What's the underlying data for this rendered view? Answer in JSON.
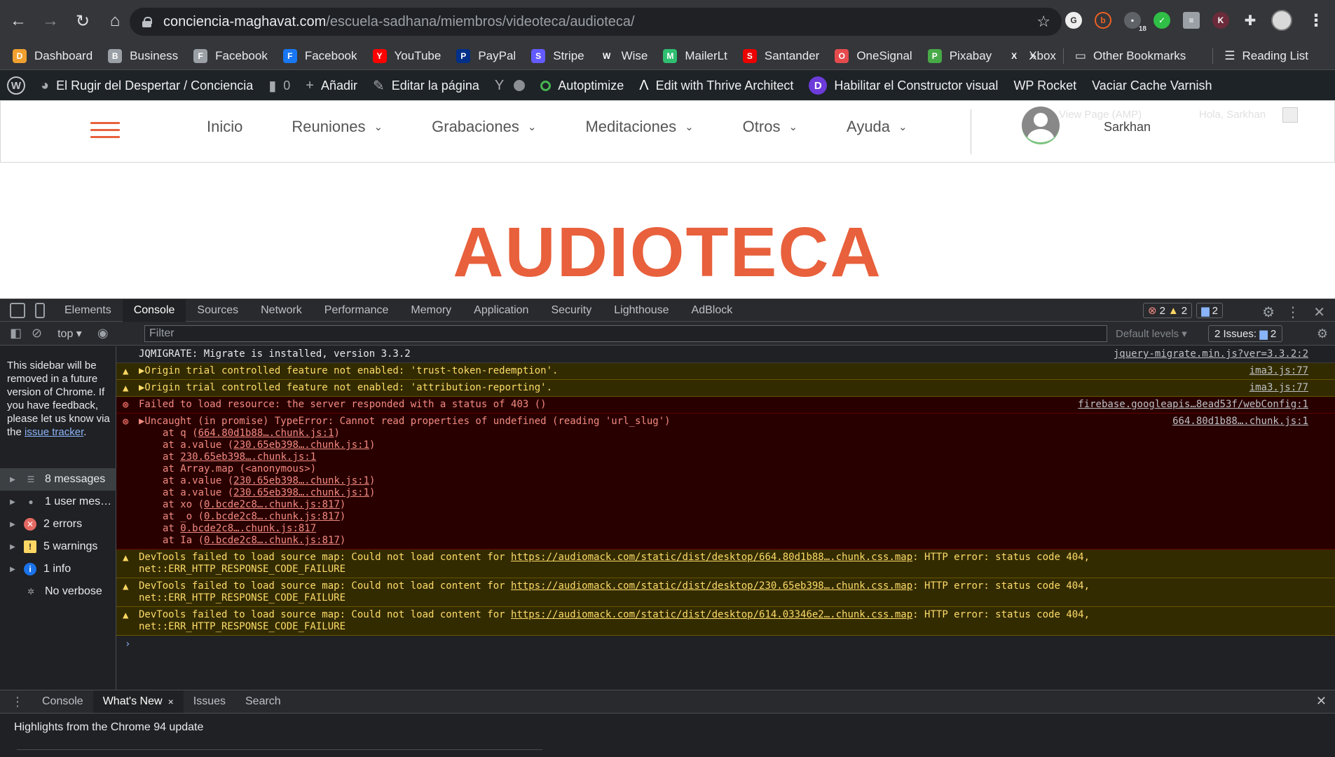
{
  "browser": {
    "url_host": "conciencia-maghavat.com",
    "url_path": "/escuela-sadhana/miembros/videoteca/audioteca/",
    "ext_badge": "18"
  },
  "bookmarks": {
    "items": [
      {
        "label": "Dashboard",
        "icon": "dashboard-icon",
        "color": "#f0a030"
      },
      {
        "label": "Business",
        "icon": "business-icon",
        "color": "#9aa0a6"
      },
      {
        "label": "Facebook",
        "icon": "facebook-doc-icon",
        "color": "#9aa0a6"
      },
      {
        "label": "Facebook",
        "icon": "facebook-icon",
        "color": "#1877f2"
      },
      {
        "label": "YouTube",
        "icon": "youtube-icon",
        "color": "#ff0000"
      },
      {
        "label": "PayPal",
        "icon": "paypal-icon",
        "color": "#003087"
      },
      {
        "label": "Stripe",
        "icon": "stripe-icon",
        "color": "#635bff"
      },
      {
        "label": "Wise",
        "icon": "wise-icon",
        "color": "#35363a"
      },
      {
        "label": "MailerLt",
        "icon": "mailerlite-icon",
        "color": "#2fbf71"
      },
      {
        "label": "Santander",
        "icon": "santander-icon",
        "color": "#ec0000"
      },
      {
        "label": "OneSignal",
        "icon": "onesignal-icon",
        "color": "#e54b4d"
      },
      {
        "label": "Pixabay",
        "icon": "pixabay-icon",
        "color": "#48a948"
      },
      {
        "label": "Xbox",
        "icon": "xbox-icon",
        "color": "#35363a"
      }
    ],
    "overflow": "»",
    "other": "Other Bookmarks",
    "reading": "Reading List"
  },
  "wpbar": {
    "site": "El Rugir del Despertar / Conciencia",
    "comments": "0",
    "add": "Añadir",
    "edit": "Editar la página",
    "autoptimize": "Autoptimize",
    "thrive": "Edit with Thrive Architect",
    "visual": "Habilitar el Constructor visual",
    "rocket": "WP Rocket",
    "varnish": "Vaciar Cache Varnish"
  },
  "site": {
    "menu": [
      {
        "label": "Inicio",
        "chevron": false
      },
      {
        "label": "Reuniones",
        "chevron": true
      },
      {
        "label": "Grabaciones",
        "chevron": true
      },
      {
        "label": "Meditaciones",
        "chevron": true
      },
      {
        "label": "Otros",
        "chevron": true
      },
      {
        "label": "Ayuda",
        "chevron": true
      }
    ],
    "user_name": "Sarkhan",
    "ghost_amp": "View Page (AMP)",
    "ghost_hello": "Hola, Sarkhan",
    "page_title": "AUDIOTECA",
    "accent": "#e8603c"
  },
  "devtools": {
    "tabs": [
      "Elements",
      "Console",
      "Sources",
      "Network",
      "Performance",
      "Memory",
      "Application",
      "Security",
      "Lighthouse",
      "AdBlock"
    ],
    "active_tab": "Console",
    "badge_errors": "2",
    "badge_warnings": "2",
    "badge_info": "2",
    "context": "top",
    "filter_placeholder": "Filter",
    "levels": "Default levels",
    "issues_label": "2 Issues:",
    "issues_count": "2",
    "sidebar_note": "This sidebar will be removed in a future version of Chrome. If you have feedback, please let us know via the",
    "sidebar_link": "issue tracker",
    "sidebar_items": [
      {
        "label": "8 messages",
        "icon": "list-icon",
        "selected": true
      },
      {
        "label": "1 user mes…",
        "icon": "user-icon",
        "selected": false
      },
      {
        "label": "2 errors",
        "icon": "error-icon",
        "selected": false
      },
      {
        "label": "5 warnings",
        "icon": "warning-icon",
        "selected": false
      },
      {
        "label": "1 info",
        "icon": "info-icon",
        "selected": false
      },
      {
        "label": "No verbose",
        "icon": "gear-icon",
        "selected": false
      }
    ],
    "messages": [
      {
        "type": "log",
        "text": "JQMIGRATE: Migrate is installed, version 3.3.2",
        "src": "jquery-migrate.min.js?ver=3.3.2:2"
      },
      {
        "type": "warn",
        "text": "▶Origin trial controlled feature not enabled: 'trust-token-redemption'.",
        "src": "ima3.js:77"
      },
      {
        "type": "warn",
        "text": "▶Origin trial controlled feature not enabled: 'attribution-reporting'.",
        "src": "ima3.js:77"
      },
      {
        "type": "err",
        "text": "Failed to load resource: the server responded with a status of 403 ()",
        "src": "firebase.googleapis…8ead53f/webConfig:1"
      },
      {
        "type": "err",
        "text": "▶Uncaught (in promise) TypeError: Cannot read properties of undefined (reading 'url_slug')",
        "src": "664.80d1b88….chunk.js:1",
        "stack": [
          {
            "pre": "at q (",
            "link": "664.80d1b88….chunk.js:1",
            "post": ")"
          },
          {
            "pre": "at a.value (",
            "link": "230.65eb398….chunk.js:1",
            "post": ")"
          },
          {
            "pre": "at ",
            "link": "230.65eb398….chunk.js:1",
            "post": ""
          },
          {
            "pre": "at Array.map (<anonymous>)",
            "link": "",
            "post": ""
          },
          {
            "pre": "at a.value (",
            "link": "230.65eb398….chunk.js:1",
            "post": ")"
          },
          {
            "pre": "at a.value (",
            "link": "230.65eb398….chunk.js:1",
            "post": ")"
          },
          {
            "pre": "at xo (",
            "link": "0.bcde2c8….chunk.js:817",
            "post": ")"
          },
          {
            "pre": "at _o (",
            "link": "0.bcde2c8….chunk.js:817",
            "post": ")"
          },
          {
            "pre": "at ",
            "link": "0.bcde2c8….chunk.js:817",
            "post": ""
          },
          {
            "pre": "at Ia (",
            "link": "0.bcde2c8….chunk.js:817",
            "post": ")"
          }
        ]
      },
      {
        "type": "warn2",
        "pre": "DevTools failed to load source map: Could not load content for ",
        "link": "https://audiomack.com/static/dist/desktop/664.80d1b88….chunk.css.map",
        "post": ": HTTP error: status code 404,",
        "line2": "net::ERR_HTTP_RESPONSE_CODE_FAILURE"
      },
      {
        "type": "warn2",
        "pre": "DevTools failed to load source map: Could not load content for ",
        "link": "https://audiomack.com/static/dist/desktop/230.65eb398….chunk.css.map",
        "post": ": HTTP error: status code 404,",
        "line2": "net::ERR_HTTP_RESPONSE_CODE_FAILURE"
      },
      {
        "type": "warn2",
        "pre": "DevTools failed to load source map: Could not load content for ",
        "link": "https://audiomack.com/static/dist/desktop/614.03346e2….chunk.css.map",
        "post": ": HTTP error: status code 404,",
        "line2": "net::ERR_HTTP_RESPONSE_CODE_FAILURE"
      }
    ],
    "drawer_tabs": [
      "Console",
      "What's New",
      "Issues",
      "Search"
    ],
    "drawer_active": "What's New",
    "drawer_text": "Highlights from the Chrome 94 update"
  }
}
